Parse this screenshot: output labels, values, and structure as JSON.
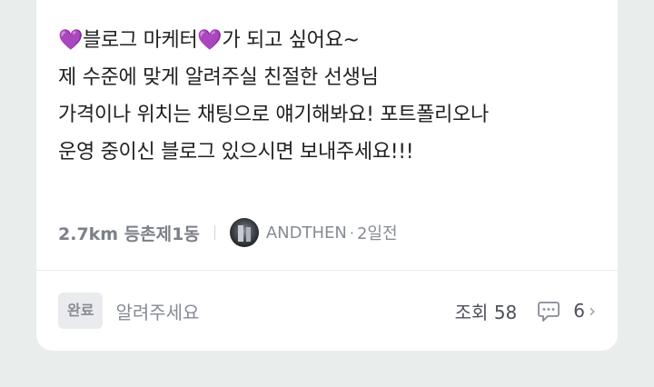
{
  "post": {
    "lines": [
      "💜블로그 마케터💜가 되고 싶어요~",
      "제 수준에 맞게 알려주실 친절한 선생님",
      "가격이나 위치는 채팅으로 얘기해봐요!  포트폴리오나",
      "운영 중이신 블로그 있으시면 보내주세요!!!"
    ],
    "distance_location": "2.7km 등촌제1동",
    "author": "ANDTHEN",
    "dot": "·",
    "time_ago": "2일전"
  },
  "footer": {
    "status_badge": "완료",
    "category": "알려주세요",
    "views": "조회 58",
    "comment_count": "6",
    "chevron": "›"
  },
  "colors": {
    "background": "#e9eeec",
    "card": "#ffffff",
    "text": "#212124",
    "muted": "#868b94"
  },
  "icons": {
    "avatar": "profile-photo",
    "comment": "speech-bubble-icon",
    "chevron": "chevron-right-icon"
  }
}
